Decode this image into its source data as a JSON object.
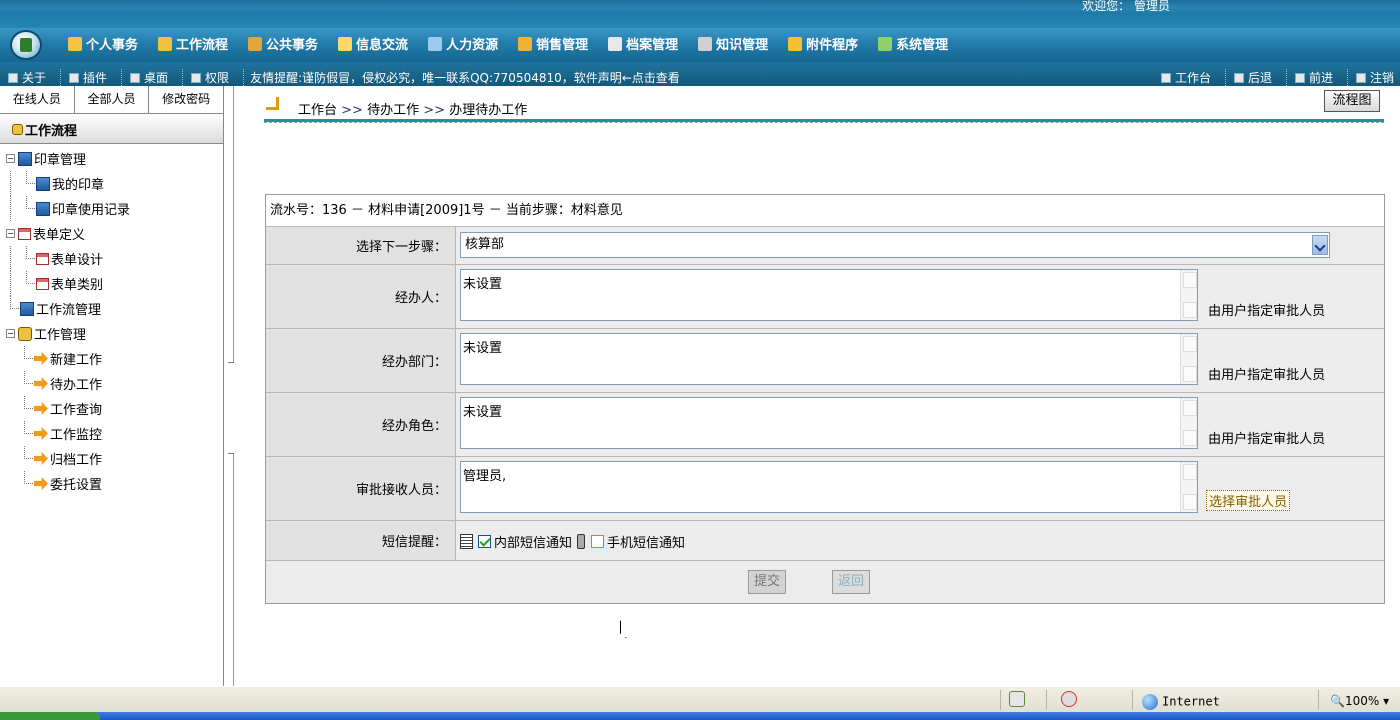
{
  "header": {
    "welcome": "欢迎您：   管理员",
    "nav": [
      {
        "label": "个人事务",
        "icon": "person-icon",
        "color": "#f6c343"
      },
      {
        "label": "工作流程",
        "icon": "flow-icon",
        "color": "#f0c040"
      },
      {
        "label": "公共事务",
        "icon": "people-icon",
        "color": "#e4a63a"
      },
      {
        "label": "信息交流",
        "icon": "chat-icon",
        "color": "#ffd86a"
      },
      {
        "label": "人力资源",
        "icon": "hr-icon",
        "color": "#9fc8f0"
      },
      {
        "label": "销售管理",
        "icon": "sales-icon",
        "color": "#f2b135"
      },
      {
        "label": "档案管理",
        "icon": "archive-icon",
        "color": "#e8e8e8"
      },
      {
        "label": "知识管理",
        "icon": "knowledge-icon",
        "color": "#d0d0d0"
      },
      {
        "label": "附件程序",
        "icon": "attachment-icon",
        "color": "#f4c030"
      },
      {
        "label": "系统管理",
        "icon": "system-icon",
        "color": "#8fd06a"
      }
    ]
  },
  "toolbar": {
    "left": [
      "关于",
      "插件",
      "桌面",
      "权限"
    ],
    "notice": "友情提醒:谨防假冒，侵权必究，唯一联系QQ:770504810，软件声明←点击查看",
    "right": [
      "工作台",
      "后退",
      "前进",
      "注销"
    ]
  },
  "sidebar": {
    "tabs": [
      "在线人员",
      "全部人员",
      "修改密码"
    ],
    "title": "工作流程",
    "tree": {
      "seal": "印章管理",
      "my_seal": "我的印章",
      "seal_log": "印章使用记录",
      "form_def": "表单定义",
      "form_design": "表单设计",
      "form_category": "表单类别",
      "flow_manage": "工作流管理",
      "work_manage": "工作管理",
      "new_work": "新建工作",
      "todo_work": "待办工作",
      "work_query": "工作查询",
      "work_monitor": "工作监控",
      "archive_work": "归档工作",
      "delegate_setting": "委托设置"
    }
  },
  "breadcrumb": {
    "items": [
      "工作台",
      "待办工作",
      "办理待办工作"
    ],
    "sep": ">>",
    "flow_button": "流程图"
  },
  "form": {
    "header": "流水号：136 － 材料申请[2009]1号 － 当前步骤：材料意见",
    "next_step_label": "选择下一步骤：",
    "next_step_value": "核算部",
    "handler_label": "经办人：",
    "handler_value": "未设置",
    "dept_label": "经办部门：",
    "dept_value": "未设置",
    "role_label": "经办角色：",
    "role_value": "未设置",
    "hint": "由用户指定审批人员",
    "receiver_label": "审批接收人员：",
    "receiver_value": "管理员,",
    "pick_button": "选择审批人员",
    "sms_label": "短信提醒：",
    "sms_internal": "内部短信通知",
    "sms_internal_checked": true,
    "sms_mobile": "手机短信通知",
    "sms_mobile_checked": false,
    "submit": "提交",
    "back": "返回"
  },
  "statusbar": {
    "zone": "Internet",
    "zoom": "100%"
  }
}
